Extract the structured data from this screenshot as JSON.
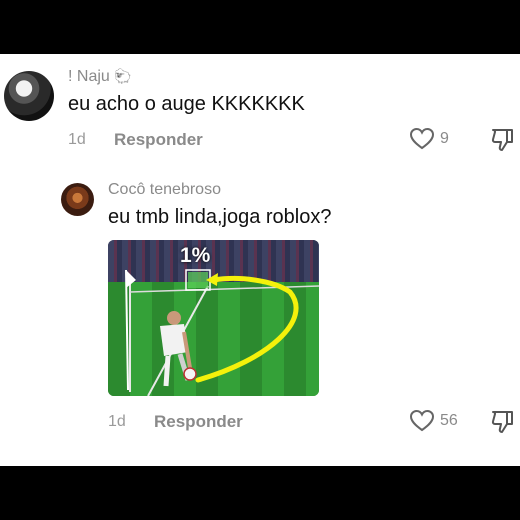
{
  "comments": [
    {
      "username": "! Naju",
      "badge": "🐑",
      "text": "eu acho o auge KKKKKKK",
      "time": "1d",
      "reply_label": "Responder",
      "likes": "9"
    },
    {
      "username": "Cocô tenebroso",
      "text": "eu tmb linda,joga roblox?",
      "time": "1d",
      "reply_label": "Responder",
      "likes": "56",
      "media": {
        "overlay_text": "1%"
      }
    }
  ],
  "icons": {
    "like": "heart-outline-icon",
    "dislike": "thumbs-down-outline-icon"
  },
  "colors": {
    "background": "#ffffff",
    "frame": "#000000",
    "muted_text": "#8a8a8a",
    "arc": "#f4f10b"
  }
}
